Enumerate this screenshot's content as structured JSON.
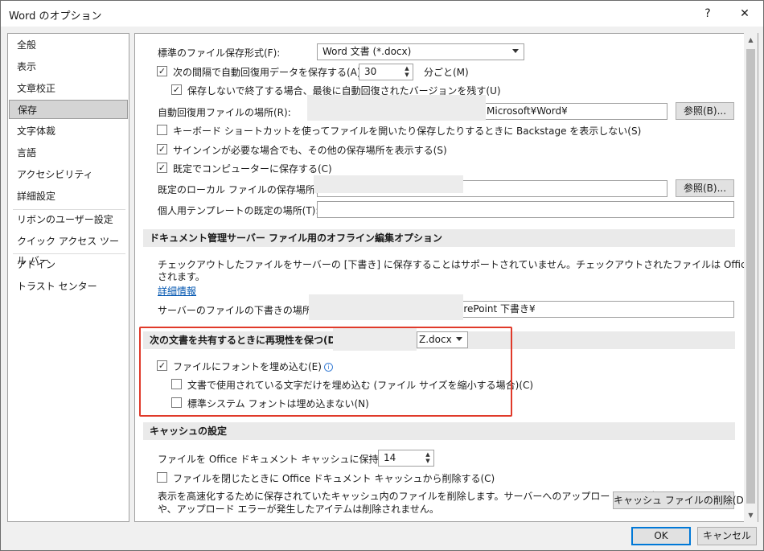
{
  "window": {
    "title": "Word のオプション",
    "help": "?",
    "close": "✕"
  },
  "sidebar": {
    "items": [
      {
        "label": "全般"
      },
      {
        "label": "表示"
      },
      {
        "label": "文章校正"
      },
      {
        "label": "保存",
        "selected": true
      },
      {
        "label": "文字体裁"
      },
      {
        "label": "言語"
      },
      {
        "label": "アクセシビリティ"
      },
      {
        "label": "詳細設定"
      },
      {
        "label": "リボンのユーザー設定"
      },
      {
        "label": "クイック アクセス ツール バー"
      },
      {
        "label": "アドイン"
      },
      {
        "label": "トラスト センター"
      }
    ]
  },
  "save": {
    "format_label": "標準のファイル保存形式(F):",
    "format_value": "Word 文書 (*.docx)",
    "autorecover_label": "次の間隔で自動回復用データを保存する(A):",
    "autorecover_checked": true,
    "autorecover_minutes": "30",
    "minutes_unit": "分ごと(M)",
    "keep_last_label": "保存しないで終了する場合、最後に自動回復されたバージョンを残す(U)",
    "keep_last_checked": true,
    "autorecover_location_label": "自動回復用ファイルの場所(R):",
    "autorecover_location_value": "Microsoft¥Word¥",
    "browse_label": "参照(B)...",
    "backstage_label": "キーボード ショートカットを使ってファイルを開いたり保存したりするときに Backstage を表示しない(S)",
    "backstage_checked": false,
    "other_locations_label": "サインインが必要な場合でも、その他の保存場所を表示する(S)",
    "other_locations_checked": true,
    "default_computer_label": "既定でコンピューターに保存する(C)",
    "default_computer_checked": true,
    "local_location_label": "既定のローカル ファイルの保存場所(I):",
    "templates_label": "個人用テンプレートの既定の場所(T):"
  },
  "offline": {
    "header": "ドキュメント管理サーバー ファイル用のオフライン編集オプション",
    "desc_line1": "チェックアウトしたファイルをサーバーの [下書き] に保存することはサポートされていません。チェックアウトされたファイルは Office ドキュメント キャッシュに保存",
    "desc_line2": "されます。",
    "more_info": "詳細情報",
    "drafts_label": "サーバーのファイルの下書きの場所(V):",
    "drafts_value": "arePoint 下書き¥"
  },
  "fidelity": {
    "header": "次の文書を共有するときに再現性を保つ(D):",
    "doc_value": "Z.docx",
    "embed_fonts_label": "ファイルにフォントを埋め込む(E)",
    "embed_fonts_checked": true,
    "info_icon": "i",
    "embed_used_label": "文書で使用されている文字だけを埋め込む (ファイル サイズを縮小する場合)(C)",
    "embed_used_checked": false,
    "no_system_fonts_label": "標準システム フォントは埋め込まない(N)",
    "no_system_fonts_checked": false
  },
  "cache": {
    "header": "キャッシュの設定",
    "days_label": "ファイルを Office ドキュメント キャッシュに保持する日数:",
    "days_value": "14",
    "delete_on_close_label": "ファイルを閉じたときに Office ドキュメント キャッシュから削除する(C)",
    "delete_on_close_checked": false,
    "desc_line1": "表示を高速化するために保存されていたキャッシュ内のファイルを削除します。サーバーへのアップロードを保留中のアイテム",
    "desc_line2": "や、アップロード エラーが発生したアイテムは削除されません。",
    "delete_button": "キャッシュ ファイルの削除(D)"
  },
  "footer": {
    "ok": "OK",
    "cancel": "キャンセル"
  },
  "colors": {
    "highlight": "#e03a2a",
    "link": "#0055b0",
    "default_button": "#0078d7"
  }
}
